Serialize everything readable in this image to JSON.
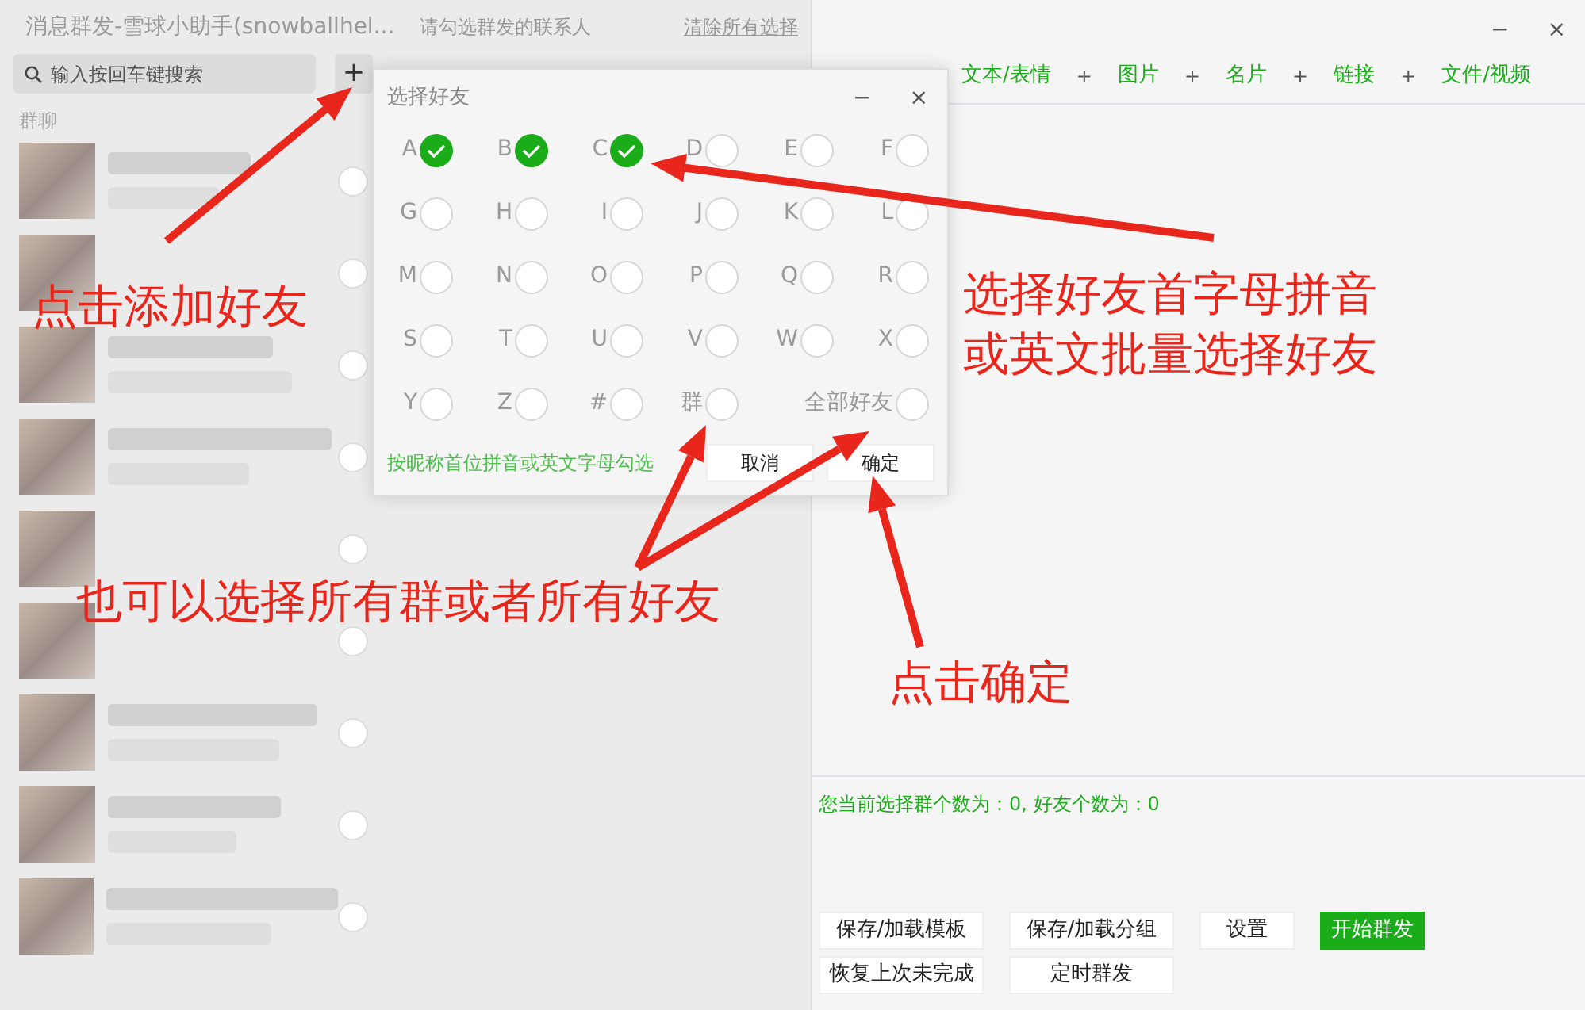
{
  "window": {
    "title": "消息群发-雪球小助手(snowballhel...",
    "subtitle": "请勾选群发的联系人",
    "clear_link": "清除所有选择",
    "controls": [
      "−",
      "×"
    ]
  },
  "search": {
    "placeholder": "输入按回车键搜索",
    "add_button": "+"
  },
  "section_label": "群聊",
  "contacts": [
    {
      "selected": false
    },
    {
      "selected": false
    },
    {
      "selected": false
    },
    {
      "selected": false
    },
    {
      "selected": false
    },
    {
      "selected": false
    },
    {
      "selected": false
    },
    {
      "selected": false
    },
    {
      "selected": false
    }
  ],
  "toolbar": {
    "items": [
      "文本/表情",
      "图片",
      "名片",
      "链接",
      "文件/视频"
    ],
    "separator": "+"
  },
  "status_text": "您当前选择群个数为：0, 好友个数为：0",
  "buttons": [
    {
      "label": "保存/加载模板",
      "kind": "default"
    },
    {
      "label": "保存/加载分组",
      "kind": "default"
    },
    {
      "label": "设置",
      "kind": "default"
    },
    {
      "label": "开始群发",
      "kind": "primary"
    },
    {
      "label": "恢复上次未完成",
      "kind": "default"
    },
    {
      "label": "定时群发",
      "kind": "default"
    }
  ],
  "dialog": {
    "title": "选择好友",
    "controls": [
      "−",
      "×"
    ],
    "options": [
      {
        "label": "A",
        "checked": true
      },
      {
        "label": "B",
        "checked": true
      },
      {
        "label": "C",
        "checked": true
      },
      {
        "label": "D",
        "checked": false
      },
      {
        "label": "E",
        "checked": false
      },
      {
        "label": "F",
        "checked": false
      },
      {
        "label": "G",
        "checked": false
      },
      {
        "label": "H",
        "checked": false
      },
      {
        "label": "I",
        "checked": false
      },
      {
        "label": "J",
        "checked": false
      },
      {
        "label": "K",
        "checked": false
      },
      {
        "label": "L",
        "checked": false
      },
      {
        "label": "M",
        "checked": false
      },
      {
        "label": "N",
        "checked": false
      },
      {
        "label": "O",
        "checked": false
      },
      {
        "label": "P",
        "checked": false
      },
      {
        "label": "Q",
        "checked": false
      },
      {
        "label": "R",
        "checked": false
      },
      {
        "label": "S",
        "checked": false
      },
      {
        "label": "T",
        "checked": false
      },
      {
        "label": "U",
        "checked": false
      },
      {
        "label": "V",
        "checked": false
      },
      {
        "label": "W",
        "checked": false
      },
      {
        "label": "X",
        "checked": false
      },
      {
        "label": "Y",
        "checked": false
      },
      {
        "label": "Z",
        "checked": false
      },
      {
        "label": "#",
        "checked": false
      },
      {
        "label": "群",
        "checked": false
      },
      {
        "label": "全部好友",
        "checked": false,
        "kind": "wide"
      }
    ],
    "hint": "按昵称首位拼音或英文字母勾选",
    "buttons": [
      "取消",
      "确定"
    ]
  },
  "annotations": [
    {
      "text": "点击添加好友"
    },
    {
      "text": "选择好友首字母拼音"
    },
    {
      "text": "或英文批量选择好友"
    },
    {
      "text": "也可以选择所有群或者所有好友"
    },
    {
      "text": "点击确定"
    }
  ]
}
